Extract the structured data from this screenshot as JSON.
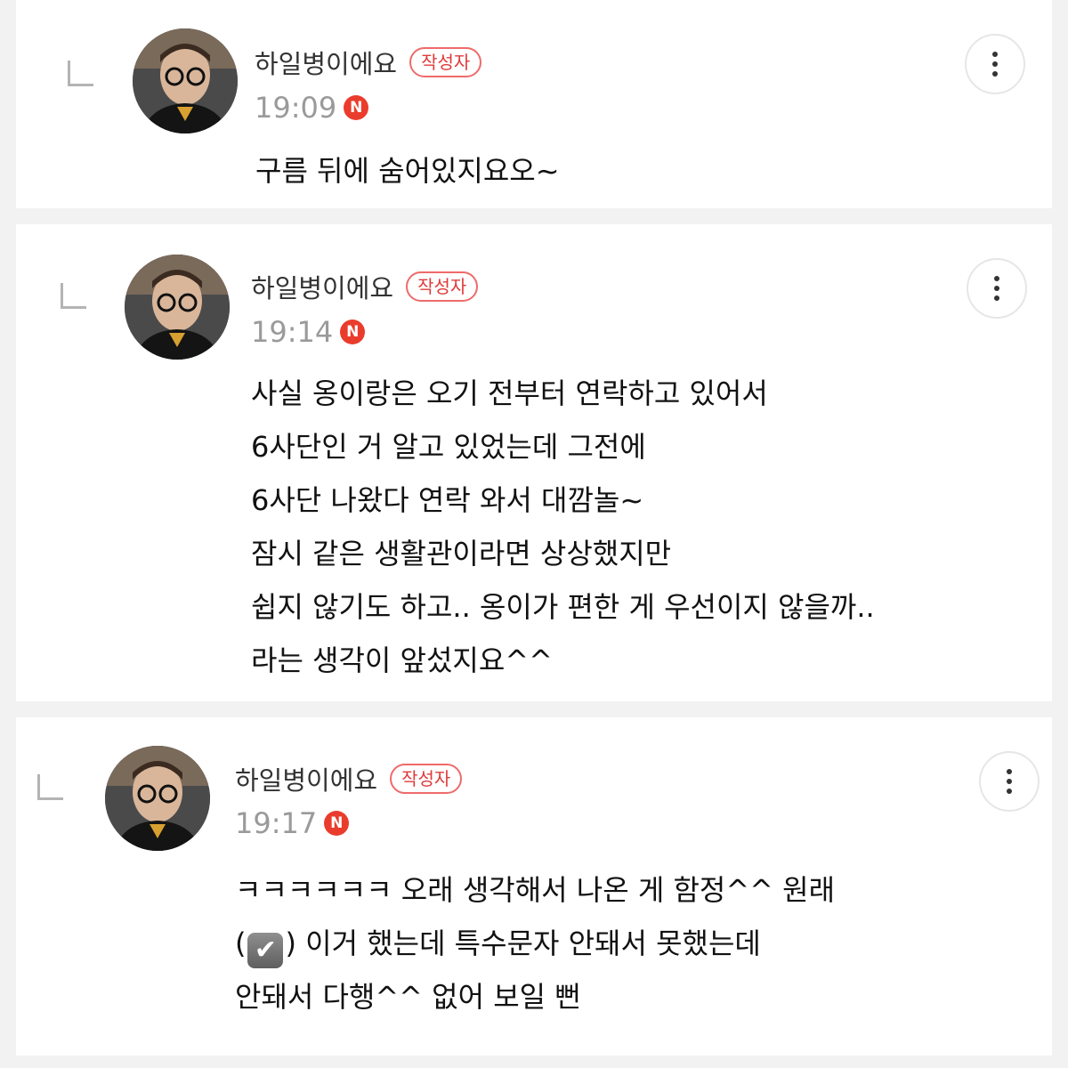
{
  "comments": [
    {
      "author": "하일병이에요",
      "badge": "작성자",
      "time": "19:09",
      "new_badge": "N",
      "lines": [
        "구름 뒤에 숨어있지요오~"
      ]
    },
    {
      "author": "하일병이에요",
      "badge": "작성자",
      "time": "19:14",
      "new_badge": "N",
      "lines": [
        "사실 옹이랑은 오기 전부터 연락하고 있어서",
        "6사단인 거 알고 있었는데 그전에",
        "6사단 나왔다 연락 와서 대깜놀~",
        "잠시 같은 생활관이라면 상상했지만",
        "쉽지 않기도 하고.. 옹이가 편한 게 우선이지 않을까..",
        "라는 생각이 앞섰지요^^"
      ]
    },
    {
      "author": "하일병이에요",
      "badge": "작성자",
      "time": "19:17",
      "new_badge": "N",
      "lines": [
        "ㅋㅋㅋㅋㅋㅋ 오래 생각해서 나온 게 함정^^ 원래",
        "이거 했는데 특수문자 안돼서 못했는데",
        "안돼서 다행^^ 없어 보일 뻔"
      ],
      "line2_prefix_open": "(",
      "line2_emoji": "✔",
      "line2_prefix_close": ")"
    }
  ],
  "icons": {
    "reply": "reply-arrow-icon",
    "more": "more-vertical-icon",
    "check": "check-box-emoji"
  },
  "colors": {
    "badge": "#e03a3a",
    "new_dot": "#ea3c2c",
    "time": "#9a9a9a"
  }
}
